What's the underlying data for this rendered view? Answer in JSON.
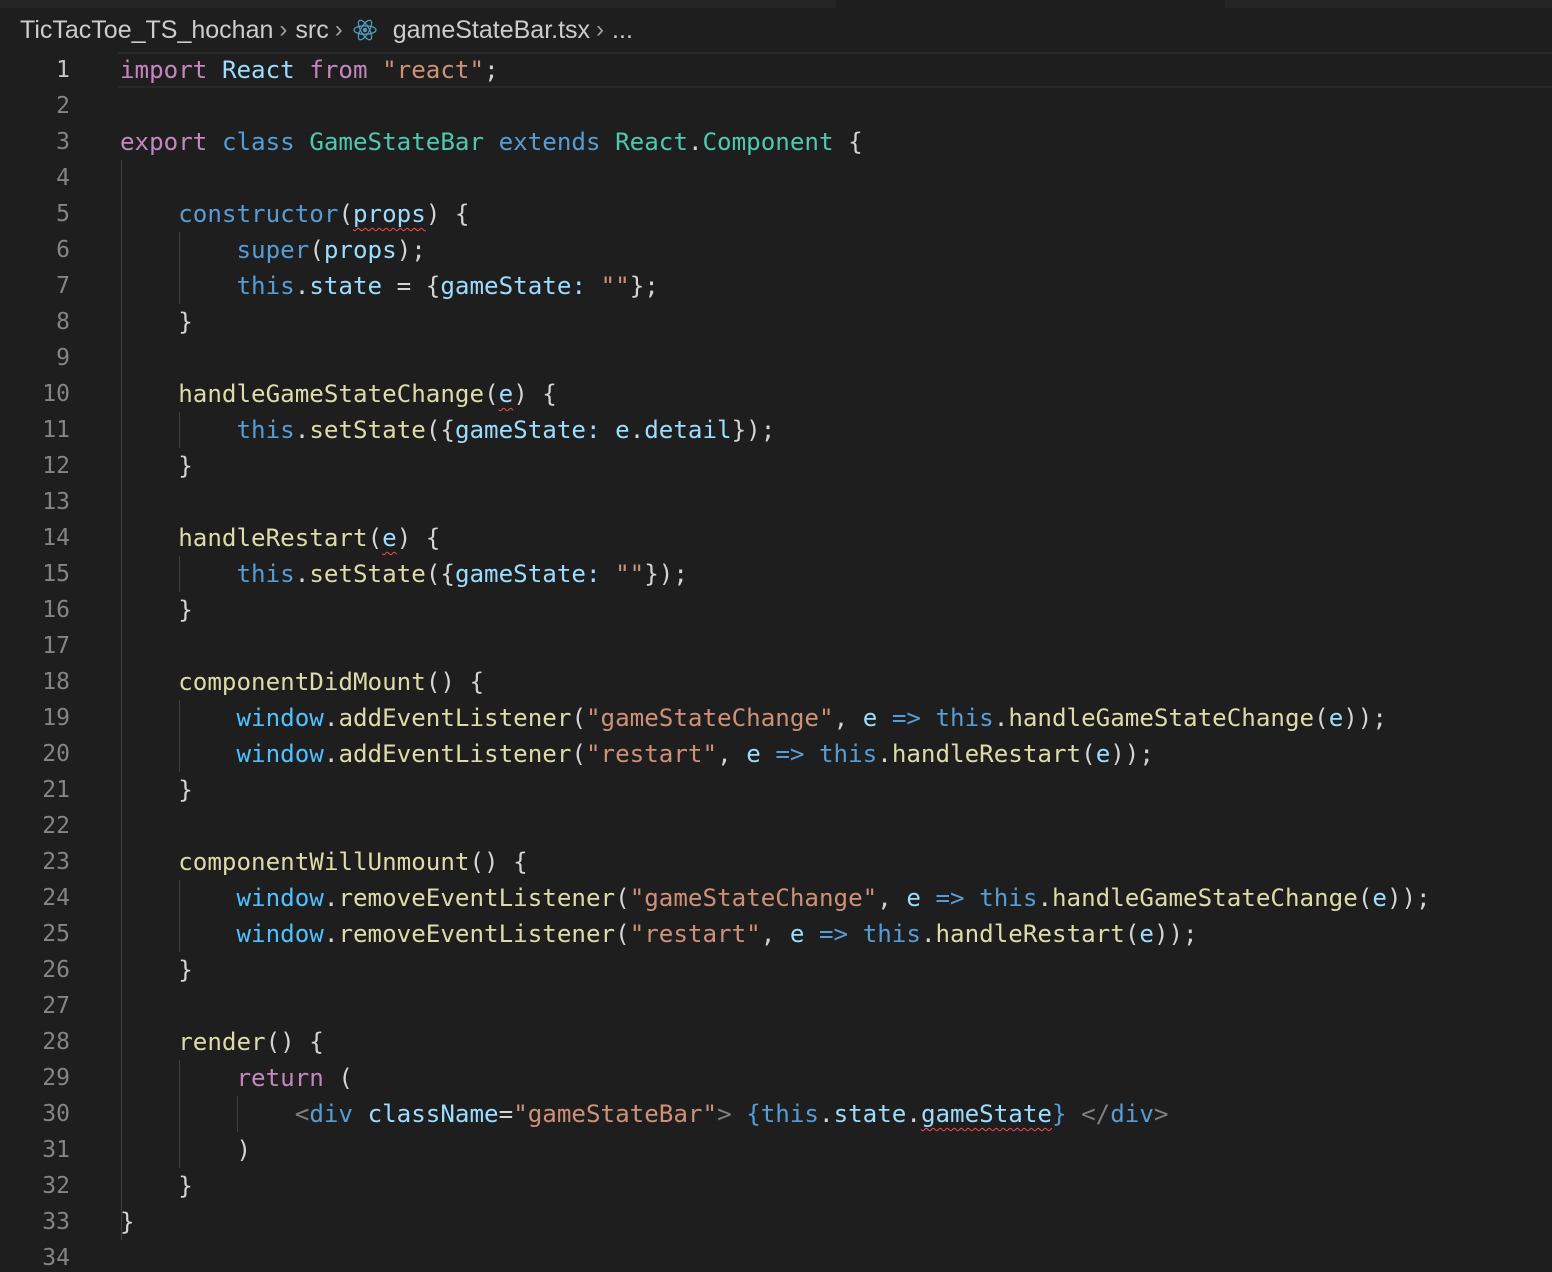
{
  "breadcrumb": {
    "project": "TicTacToe_TS_hochan",
    "folder": "src",
    "file": "gameStateBar.tsx",
    "more": "...",
    "file_icon": "react-icon"
  },
  "editor": {
    "active_line": 1,
    "line_numbers": [
      "1",
      "2",
      "3",
      "4",
      "5",
      "6",
      "7",
      "8",
      "9",
      "10",
      "11",
      "12",
      "13",
      "14",
      "15",
      "16",
      "17",
      "18",
      "19",
      "20",
      "21",
      "22",
      "23",
      "24",
      "25",
      "26",
      "27",
      "28",
      "29",
      "30",
      "31",
      "32",
      "33",
      "34"
    ],
    "lines": [
      [
        [
          "kw-ctrl",
          "import"
        ],
        [
          "pun",
          " "
        ],
        [
          "var",
          "React"
        ],
        [
          "pun",
          " "
        ],
        [
          "kw-ctrl",
          "from"
        ],
        [
          "pun",
          " "
        ],
        [
          "str",
          "\"react\""
        ],
        [
          "pun",
          ";"
        ]
      ],
      [],
      [
        [
          "kw-ctrl",
          "export"
        ],
        [
          "pun",
          " "
        ],
        [
          "kw",
          "class"
        ],
        [
          "pun",
          " "
        ],
        [
          "type",
          "GameStateBar"
        ],
        [
          "pun",
          " "
        ],
        [
          "kw",
          "extends"
        ],
        [
          "pun",
          " "
        ],
        [
          "type",
          "React"
        ],
        [
          "pun",
          "."
        ],
        [
          "type",
          "Component"
        ],
        [
          "pun",
          " {"
        ]
      ],
      [],
      [
        [
          "pun",
          "    "
        ],
        [
          "kw",
          "constructor"
        ],
        [
          "pun",
          "("
        ],
        [
          "var squiggle",
          "props"
        ],
        [
          "pun",
          ") {"
        ]
      ],
      [
        [
          "pun",
          "        "
        ],
        [
          "kw",
          "super"
        ],
        [
          "pun",
          "("
        ],
        [
          "var",
          "props"
        ],
        [
          "pun",
          ");"
        ]
      ],
      [
        [
          "pun",
          "        "
        ],
        [
          "kw",
          "this"
        ],
        [
          "pun",
          "."
        ],
        [
          "var",
          "state"
        ],
        [
          "pun",
          " = {"
        ],
        [
          "var",
          "gameState"
        ],
        [
          "var",
          ":"
        ],
        [
          "pun",
          " "
        ],
        [
          "str",
          "\"\""
        ],
        [
          "pun",
          "};"
        ]
      ],
      [
        [
          "pun",
          "    }"
        ]
      ],
      [],
      [
        [
          "pun",
          "    "
        ],
        [
          "fn",
          "handleGameStateChange"
        ],
        [
          "pun",
          "("
        ],
        [
          "var squiggle",
          "e"
        ],
        [
          "pun",
          ") {"
        ]
      ],
      [
        [
          "pun",
          "        "
        ],
        [
          "kw",
          "this"
        ],
        [
          "pun",
          "."
        ],
        [
          "fn",
          "setState"
        ],
        [
          "pun",
          "({"
        ],
        [
          "var",
          "gameState"
        ],
        [
          "var",
          ":"
        ],
        [
          "pun",
          " "
        ],
        [
          "var",
          "e"
        ],
        [
          "pun",
          "."
        ],
        [
          "var",
          "detail"
        ],
        [
          "pun",
          "});"
        ]
      ],
      [
        [
          "pun",
          "    }"
        ]
      ],
      [],
      [
        [
          "pun",
          "    "
        ],
        [
          "fn",
          "handleRestart"
        ],
        [
          "pun",
          "("
        ],
        [
          "var squiggle",
          "e"
        ],
        [
          "pun",
          ") {"
        ]
      ],
      [
        [
          "pun",
          "        "
        ],
        [
          "kw",
          "this"
        ],
        [
          "pun",
          "."
        ],
        [
          "fn",
          "setState"
        ],
        [
          "pun",
          "({"
        ],
        [
          "var",
          "gameState"
        ],
        [
          "var",
          ":"
        ],
        [
          "pun",
          " "
        ],
        [
          "str",
          "\"\""
        ],
        [
          "pun",
          "});"
        ]
      ],
      [
        [
          "pun",
          "    }"
        ]
      ],
      [],
      [
        [
          "pun",
          "    "
        ],
        [
          "fn",
          "componentDidMount"
        ],
        [
          "pun",
          "() {"
        ]
      ],
      [
        [
          "pun",
          "        "
        ],
        [
          "vconst",
          "window"
        ],
        [
          "pun",
          "."
        ],
        [
          "fn",
          "addEventListener"
        ],
        [
          "pun",
          "("
        ],
        [
          "str",
          "\"gameStateChange\""
        ],
        [
          "pun",
          ", "
        ],
        [
          "var",
          "e"
        ],
        [
          "pun",
          " "
        ],
        [
          "kw",
          "=>"
        ],
        [
          "pun",
          " "
        ],
        [
          "kw",
          "this"
        ],
        [
          "pun",
          "."
        ],
        [
          "fn",
          "handleGameStateChange"
        ],
        [
          "pun",
          "("
        ],
        [
          "var",
          "e"
        ],
        [
          "pun",
          "));"
        ]
      ],
      [
        [
          "pun",
          "        "
        ],
        [
          "vconst",
          "window"
        ],
        [
          "pun",
          "."
        ],
        [
          "fn",
          "addEventListener"
        ],
        [
          "pun",
          "("
        ],
        [
          "str",
          "\"restart\""
        ],
        [
          "pun",
          ", "
        ],
        [
          "var",
          "e"
        ],
        [
          "pun",
          " "
        ],
        [
          "kw",
          "=>"
        ],
        [
          "pun",
          " "
        ],
        [
          "kw",
          "this"
        ],
        [
          "pun",
          "."
        ],
        [
          "fn",
          "handleRestart"
        ],
        [
          "pun",
          "("
        ],
        [
          "var",
          "e"
        ],
        [
          "pun",
          "));"
        ]
      ],
      [
        [
          "pun",
          "    }"
        ]
      ],
      [],
      [
        [
          "pun",
          "    "
        ],
        [
          "fn",
          "componentWillUnmount"
        ],
        [
          "pun",
          "() {"
        ]
      ],
      [
        [
          "pun",
          "        "
        ],
        [
          "vconst",
          "window"
        ],
        [
          "pun",
          "."
        ],
        [
          "fn",
          "removeEventListener"
        ],
        [
          "pun",
          "("
        ],
        [
          "str",
          "\"gameStateChange\""
        ],
        [
          "pun",
          ", "
        ],
        [
          "var",
          "e"
        ],
        [
          "pun",
          " "
        ],
        [
          "kw",
          "=>"
        ],
        [
          "pun",
          " "
        ],
        [
          "kw",
          "this"
        ],
        [
          "pun",
          "."
        ],
        [
          "fn",
          "handleGameStateChange"
        ],
        [
          "pun",
          "("
        ],
        [
          "var",
          "e"
        ],
        [
          "pun",
          "));"
        ]
      ],
      [
        [
          "pun",
          "        "
        ],
        [
          "vconst",
          "window"
        ],
        [
          "pun",
          "."
        ],
        [
          "fn",
          "removeEventListener"
        ],
        [
          "pun",
          "("
        ],
        [
          "str",
          "\"restart\""
        ],
        [
          "pun",
          ", "
        ],
        [
          "var",
          "e"
        ],
        [
          "pun",
          " "
        ],
        [
          "kw",
          "=>"
        ],
        [
          "pun",
          " "
        ],
        [
          "kw",
          "this"
        ],
        [
          "pun",
          "."
        ],
        [
          "fn",
          "handleRestart"
        ],
        [
          "pun",
          "("
        ],
        [
          "var",
          "e"
        ],
        [
          "pun",
          "));"
        ]
      ],
      [
        [
          "pun",
          "    }"
        ]
      ],
      [],
      [
        [
          "pun",
          "    "
        ],
        [
          "fn",
          "render"
        ],
        [
          "pun",
          "() {"
        ]
      ],
      [
        [
          "pun",
          "        "
        ],
        [
          "kw-ctrl",
          "return"
        ],
        [
          "pun",
          " ("
        ]
      ],
      [
        [
          "pun",
          "            "
        ],
        [
          "tagbr",
          "<"
        ],
        [
          "tag",
          "div"
        ],
        [
          "pun",
          " "
        ],
        [
          "var",
          "className"
        ],
        [
          "pun",
          "="
        ],
        [
          "str",
          "\"gameStateBar\""
        ],
        [
          "tagbr",
          ">"
        ],
        [
          "pun",
          " "
        ],
        [
          "kw",
          "{"
        ],
        [
          "kw",
          "this"
        ],
        [
          "pun",
          "."
        ],
        [
          "var",
          "state"
        ],
        [
          "pun",
          "."
        ],
        [
          "var squiggle",
          "gameState"
        ],
        [
          "kw",
          "}"
        ],
        [
          "pun",
          " "
        ],
        [
          "tagbr",
          "</"
        ],
        [
          "tag",
          "div"
        ],
        [
          "tagbr",
          ">"
        ]
      ],
      [
        [
          "pun",
          "        )"
        ]
      ],
      [
        [
          "pun",
          "    }"
        ]
      ],
      [
        [
          "pun",
          "}"
        ]
      ],
      []
    ]
  }
}
